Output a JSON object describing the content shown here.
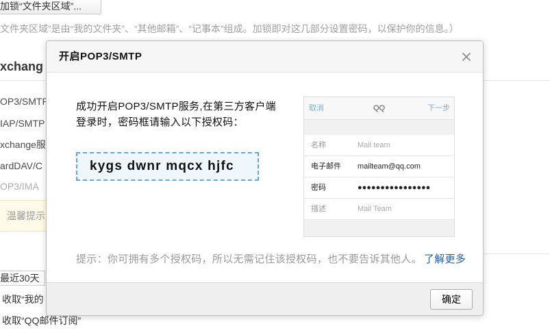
{
  "background": {
    "lock_button_label": "加锁“文件夹区域”...",
    "lock_note": "文件夹区域”是由“我的文件夹”、“其他邮箱”、“记事本”组成。加锁即对这几部分设置密码，以保护你的信息。）",
    "section_heading": "xchang",
    "service_rows": [
      "OP3/SMTP",
      "IAP/SMTP",
      "xchange服",
      "ardDAV/C",
      "OP3/IMA"
    ],
    "notice_label": "温馨提示",
    "period_select_value": "最近30天",
    "receive_options": [
      "收取“我的",
      "收取“QQ邮件订阅”"
    ]
  },
  "dialog": {
    "title": "开启POP3/SMTP",
    "close_icon": "close-icon",
    "message_lines": [
      "成功开启POP3/SMTP服务,在第三方客户端",
      "登录时，密码框请输入以下授权码："
    ],
    "auth_code": "kygs dwnr mqcx hjfc",
    "client_example": {
      "cancel_label": "取消",
      "account_title": "QQ",
      "next_label": "下一步",
      "fields": [
        {
          "label": "名称",
          "value": "Mail team",
          "is_placeholder": true
        },
        {
          "label": "电子邮件",
          "value": "mailteam@qq.com",
          "is_placeholder": false
        },
        {
          "label": "密码",
          "value": "●●●●●●●●●●●●●●●●",
          "is_placeholder": false
        },
        {
          "label": "描述",
          "value": "Mail Team",
          "is_placeholder": true
        }
      ]
    },
    "tip_text": "提示：你可拥有多个授权码，所以无需记住该授权码，也不要告诉其他人。",
    "learn_more_label": "了解更多",
    "confirm_label": "确定"
  },
  "colors": {
    "link": "#1f5fa8",
    "auth_code_border": "#5ea9d9",
    "auth_code_background": "#f0f7fc",
    "example_link": "#72b3ea"
  }
}
